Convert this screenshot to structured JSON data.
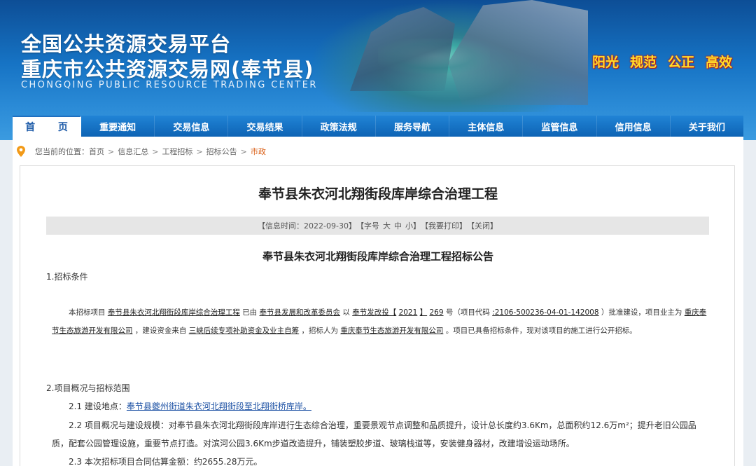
{
  "header": {
    "title_line1": "全国公共资源交易平台",
    "title_line2": "重庆市公共资源交易网(奉节县)",
    "title_en": "CHONGQING PUBLIC RESOURCE TRADING CENTER",
    "slogans": [
      "阳光",
      "规范",
      "公正",
      "高效"
    ],
    "colors": {
      "banner": "#1673c4",
      "slogan": "#ffdf2b",
      "slogan_outline": "#b8191a"
    }
  },
  "nav": {
    "items": [
      "首 页",
      "重要通知",
      "交易信息",
      "交易结果",
      "政策法规",
      "服务导航",
      "主体信息",
      "监管信息",
      "信用信息",
      "关于我们"
    ],
    "active_index": 0
  },
  "breadcrumb": {
    "prefix": "您当前的位置：",
    "items": [
      "首页",
      "信息汇总",
      "工程招标",
      "招标公告"
    ],
    "current": "市政",
    "separator": ">"
  },
  "article": {
    "title": "奉节县朱衣河北翔街段库岸综合治理工程",
    "meta": {
      "info_time": "【信息时间：2022-09-30】",
      "font_label": "【字号",
      "font_large": "大",
      "font_medium": "中",
      "font_small": "小】",
      "print": "【我要打印】",
      "close": "【关闭】"
    },
    "notice_title": "奉节县朱衣河北翔街段库岸综合治理工程招标公告",
    "section1": {
      "heading": "1.招标条件",
      "t1": "本招标项目",
      "project_name": "奉节县朱衣河北翔街段库岸综合治理工程",
      "t2": "已由",
      "approver": "奉节县发展和改革委员会",
      "t3": "以",
      "doc_prefix": "奉节发改投【",
      "doc_year": "2021",
      "doc_mid": "】",
      "doc_no": "269",
      "t4": "号（项目代码",
      "project_code": ":2106-500236-04-01-142008",
      "t5": "）批准建设，项目业主为",
      "owner": "重庆奉节生态旅游开发有限公司",
      "t6": "，建设资金来自",
      "fund": "三峡后续专项补助资金及业主自筹",
      "t7": "，招标人为",
      "tenderer": "重庆奉节生态旅游开发有限公司",
      "t8": "。项目已具备招标条件，现对该项目的施工进行公开招标。"
    },
    "section2": {
      "heading": "2.项目概况与招标范围",
      "item1_label": "2.1  建设地点：",
      "item1_value": "奉节县夔州街道朱衣河北翔街段至北翔街桥库岸。",
      "item2_line1": "2.2  项目概况与建设规模：对奉节县朱衣河北翔街段库岸进行生态综合治理，重要景观节点调整和品质提升，设计总长度约3.6Km，总面积约12.6万m²；提升老旧公园品",
      "item2_line2": "质，配套公园管理设施，重要节点打造。对滨河公园3.6Km步道改造提升，铺装塑胶步道、玻璃栈道等，安装健身器材，改建增设运动场所。",
      "item3": "2.3  本次招标项目合同估算金额：约2655.28万元。"
    }
  }
}
